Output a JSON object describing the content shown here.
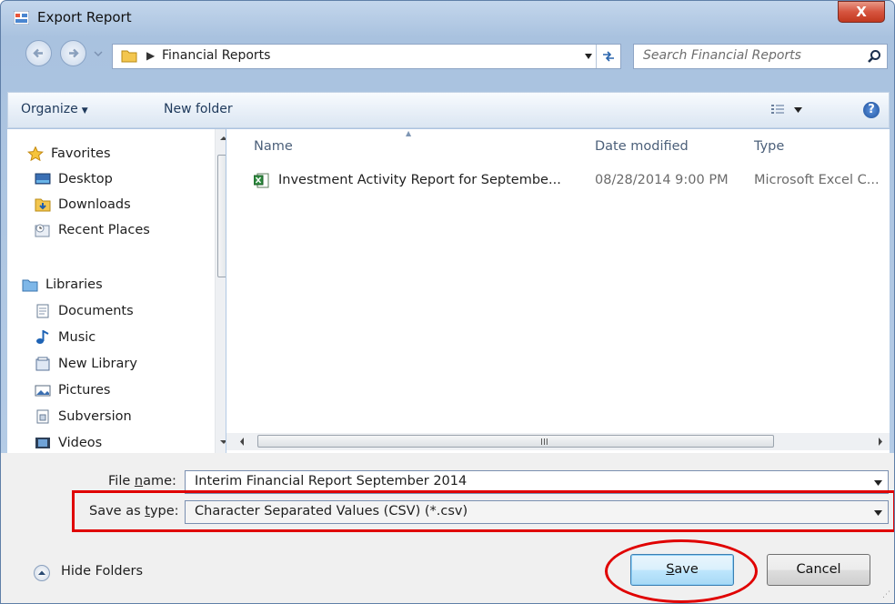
{
  "window": {
    "title": "Export Report",
    "close_label": "X"
  },
  "address_bar": {
    "separator": "▶",
    "path": "Financial Reports"
  },
  "search": {
    "placeholder": "Search Financial Reports"
  },
  "toolbar": {
    "organize_label": "Organize",
    "organize_caret": "▼",
    "new_folder_label": "New folder",
    "help_label": "?"
  },
  "navigation": {
    "favorites": [
      {
        "label": "Favorites",
        "icon": "star-icon"
      },
      {
        "label": "Desktop",
        "icon": "desktop-icon"
      },
      {
        "label": "Downloads",
        "icon": "downloads-folder-icon"
      },
      {
        "label": "Recent Places",
        "icon": "recent-places-icon"
      }
    ],
    "libraries": [
      {
        "label": "Libraries",
        "icon": "libraries-icon"
      },
      {
        "label": "Documents",
        "icon": "documents-icon"
      },
      {
        "label": "Music",
        "icon": "music-icon"
      },
      {
        "label": "New Library",
        "icon": "library-icon"
      },
      {
        "label": "Pictures",
        "icon": "pictures-icon"
      },
      {
        "label": "Subversion",
        "icon": "subversion-icon"
      },
      {
        "label": "Videos",
        "icon": "videos-icon"
      }
    ]
  },
  "file_list": {
    "columns": [
      "Name",
      "Date modified",
      "Type"
    ],
    "files": [
      {
        "name": "Investment Activity Report for Septembe...",
        "date": "08/28/2014 9:00 PM",
        "type": "Microsoft Excel C...",
        "icon": "excel-file-icon"
      }
    ]
  },
  "form": {
    "file_name_label": "File name:",
    "file_name_value": "Interim Financial Report September 2014",
    "save_type_label": "Save as type:",
    "save_type_value": "Character Separated Values (CSV) (*.csv)"
  },
  "footer": {
    "hide_folders_label": "Hide Folders",
    "save_label": "Save",
    "cancel_label": "Cancel"
  },
  "colors": {
    "highlight": "#e00000",
    "accent": "#1c5fae"
  }
}
